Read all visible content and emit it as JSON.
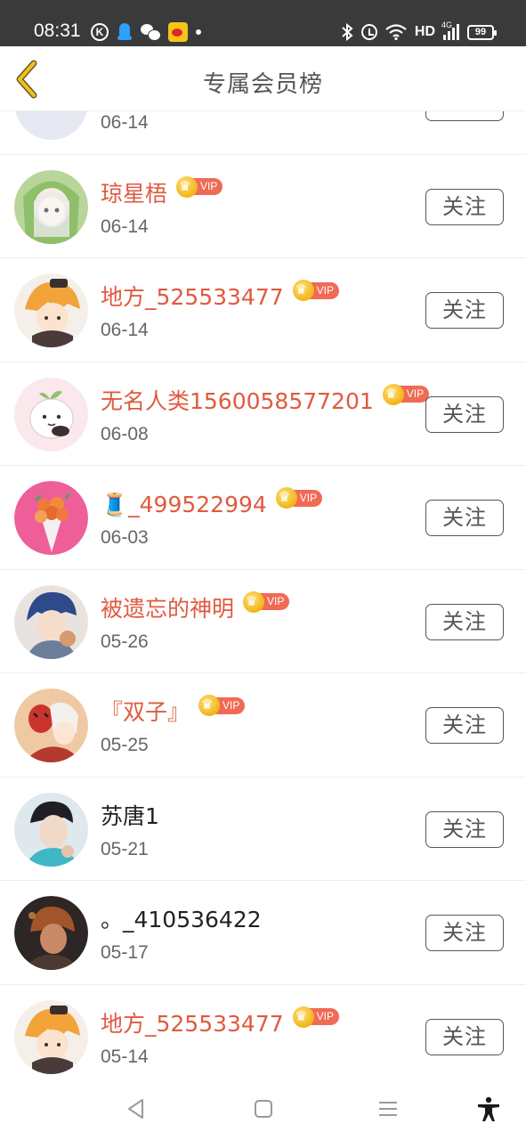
{
  "status_bar": {
    "time": "08:31",
    "left_icons": [
      "k-app-icon",
      "qq-icon",
      "wechat-icon",
      "weibo-icon",
      "notification-dot"
    ],
    "right_icons": [
      "bluetooth-icon",
      "alarm-icon",
      "wifi-icon",
      "hd-label",
      "signal-4g-icon",
      "battery-icon"
    ],
    "hd_label": "HD",
    "network_label": "4G",
    "battery": "99"
  },
  "header": {
    "title": "专属会员榜",
    "back_icon": "chevron-left-icon",
    "back_color": "#f0c020"
  },
  "colors": {
    "vip_name": "#e05a3f",
    "vip_badge": "#f06a55",
    "crown": "#f2b418",
    "normal_name": "#222222",
    "date": "#666666"
  },
  "vip_badge_label": "VIP",
  "follow_label": "关注",
  "members": [
    {
      "name": "",
      "date": "06-14",
      "vip": false,
      "avatar": "avatar-partial"
    },
    {
      "name": "琼星梧",
      "date": "06-14",
      "vip": true,
      "avatar": "anime-white-hair-green-hood"
    },
    {
      "name": "地方_525533477",
      "date": "06-14",
      "vip": true,
      "avatar": "anime-orange-hair-boy"
    },
    {
      "name": "无名人类1560058577201",
      "date": "06-08",
      "vip": true,
      "avatar": "cute-sprout-character"
    },
    {
      "name": "🧵_499522994",
      "date": "06-03",
      "vip": true,
      "avatar": "flower-bouquet"
    },
    {
      "name": "被遗忘的神明",
      "date": "05-26",
      "vip": true,
      "avatar": "anime-blue-hair-boy"
    },
    {
      "name": "『双子』",
      "date": "05-25",
      "vip": true,
      "avatar": "anime-red-mask-character"
    },
    {
      "name": "苏唐1",
      "date": "05-21",
      "vip": false,
      "avatar": "photo-young-man"
    },
    {
      "name": "。_410536422",
      "date": "05-17",
      "vip": false,
      "avatar": "dark-anime-character"
    },
    {
      "name": "地方_525533477",
      "date": "05-14",
      "vip": true,
      "avatar": "anime-orange-hair-boy"
    }
  ],
  "nav_bar": {
    "buttons": [
      "back-triangle-icon",
      "home-square-icon",
      "recents-menu-icon",
      "accessibility-icon"
    ]
  }
}
